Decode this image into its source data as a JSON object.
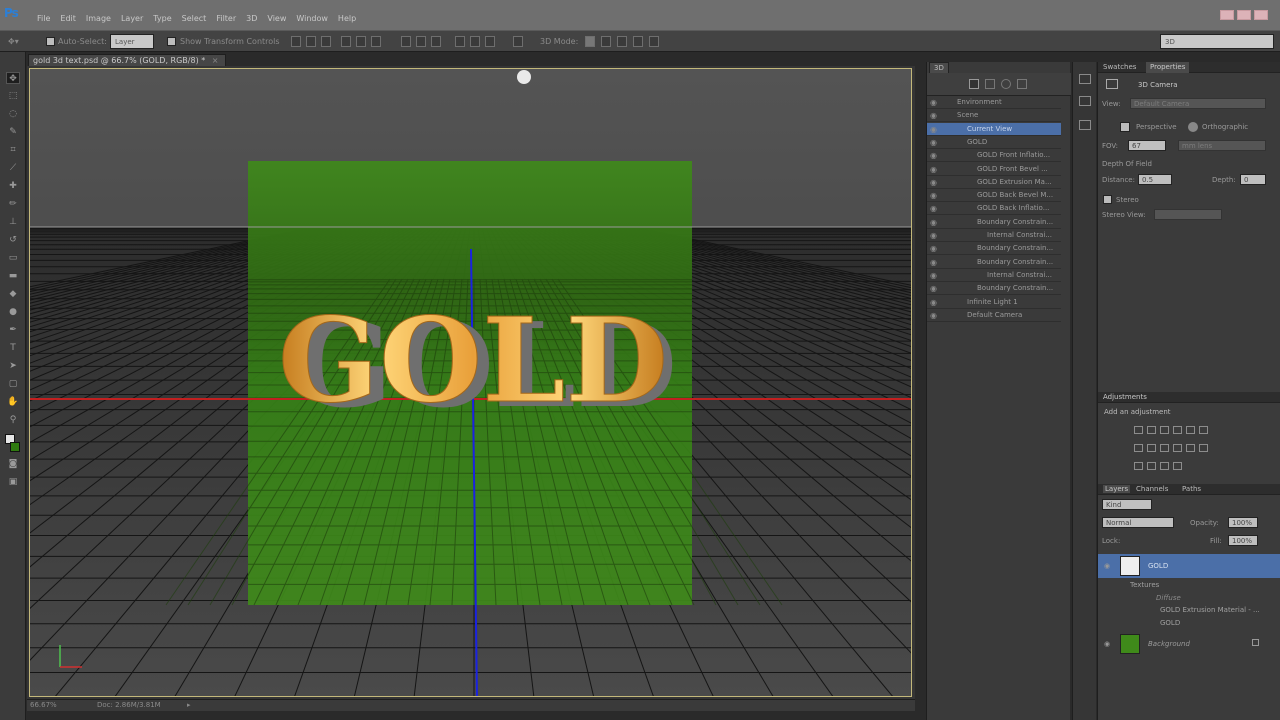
{
  "app": {
    "logo": "Ps"
  },
  "menu": [
    "File",
    "Edit",
    "Image",
    "Layer",
    "Type",
    "Select",
    "Filter",
    "3D",
    "View",
    "Window",
    "Help"
  ],
  "options": {
    "auto_select_label": "Auto-Select:",
    "auto_select_value": "Layer",
    "show_transform_label": "Show Transform Controls",
    "mode_3d_label": "3D Mode:",
    "workspace_value": "3D"
  },
  "document": {
    "tab_title": "gold 3d text.psd @ 66.7% (GOLD, RGB/8) *",
    "zoom": "66.67%",
    "doc_size": "Doc: 2.86M/3.81M",
    "canvas_text": "GOLD"
  },
  "panel_3d": {
    "tab": "3D",
    "rows": [
      {
        "label": "Environment",
        "indent": 0
      },
      {
        "label": "Scene",
        "indent": 0
      },
      {
        "label": "Current View",
        "indent": 1,
        "selected": true
      },
      {
        "label": "GOLD",
        "indent": 1
      },
      {
        "label": "GOLD Front Inflatio...",
        "indent": 2
      },
      {
        "label": "GOLD Front Bevel ...",
        "indent": 2
      },
      {
        "label": "GOLD Extrusion Ma...",
        "indent": 2
      },
      {
        "label": "GOLD Back Bevel M...",
        "indent": 2
      },
      {
        "label": "GOLD Back Inflatio...",
        "indent": 2
      },
      {
        "label": "Boundary Constrain...",
        "indent": 2
      },
      {
        "label": "Internal Constrai...",
        "indent": 3
      },
      {
        "label": "Boundary Constrain...",
        "indent": 2
      },
      {
        "label": "Boundary Constrain...",
        "indent": 2
      },
      {
        "label": "Internal Constrai...",
        "indent": 3
      },
      {
        "label": "Boundary Constrain...",
        "indent": 2
      },
      {
        "label": "Infinite Light 1",
        "indent": 1
      },
      {
        "label": "Default Camera",
        "indent": 1
      }
    ]
  },
  "properties": {
    "tab_swatches": "Swatches",
    "tab_properties": "Properties",
    "title": "3D Camera",
    "view_label": "View:",
    "view_value": "Default Camera",
    "perspective_label": "Perspective",
    "orthographic_label": "Orthographic",
    "fov_label": "FOV:",
    "fov_value": "67",
    "fov_units": "mm lens",
    "dof_label": "Depth Of Field",
    "distance_label": "Distance:",
    "distance_value": "0.5",
    "depth_label": "Depth:",
    "depth_value": "0",
    "stereo_label": "Stereo",
    "stereo_view_label": "Stereo View:"
  },
  "adjustments": {
    "tab": "Adjustments",
    "add_label": "Add an adjustment"
  },
  "layers": {
    "tabs": [
      "Layers",
      "Channels",
      "Paths"
    ],
    "kind_value": "Kind",
    "blend_value": "Normal",
    "opacity_label": "Opacity:",
    "opacity_value": "100%",
    "lock_label": "Lock:",
    "fill_label": "Fill:",
    "fill_value": "100%",
    "items": [
      {
        "label": "GOLD",
        "type": "3d",
        "selected": true
      },
      {
        "label": "Textures",
        "type": "sub"
      },
      {
        "label": "Diffuse",
        "type": "sub2"
      },
      {
        "label": "GOLD Extrusion Material - ...",
        "type": "sub3"
      },
      {
        "label": "GOLD",
        "type": "sub3"
      },
      {
        "label": "Background",
        "type": "bg"
      }
    ]
  },
  "colors": {
    "green_plane": "#3f8a1a",
    "accent_selection": "#4b6fa8",
    "gold": "#e6a73a"
  }
}
